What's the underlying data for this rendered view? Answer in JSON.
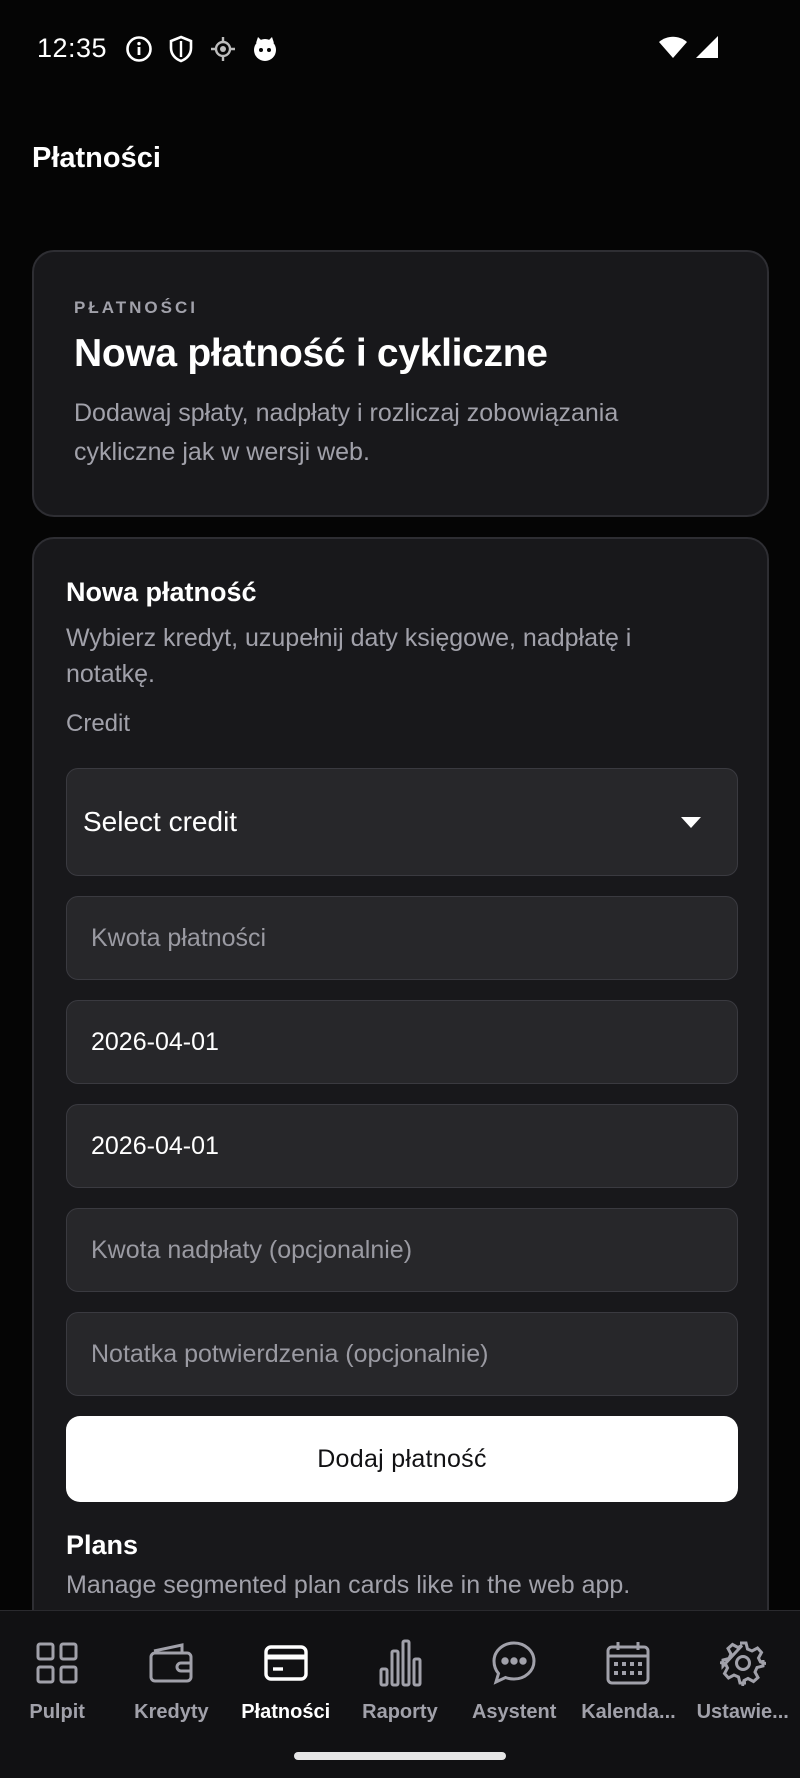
{
  "status_bar": {
    "time": "12:35",
    "icons": [
      "info-icon",
      "shield-icon",
      "location-icon",
      "cat-icon"
    ],
    "right_icons": [
      "wifi-icon",
      "signal-icon"
    ]
  },
  "header": {
    "title": "Płatności"
  },
  "hero": {
    "eyebrow": "PŁATNOŚCI",
    "title": "Nowa płatność i cykliczne",
    "description": "Dodawaj spłaty, nadpłaty i rozliczaj zobowiązania cykliczne jak w wersji web."
  },
  "form": {
    "title": "Nowa płatność",
    "description": "Wybierz kredyt, uzupełnij daty księgowe, nadpłatę i notatkę.",
    "credit_label": "Credit",
    "credit_select": {
      "value": "Select credit"
    },
    "amount": {
      "value": "",
      "placeholder": "Kwota płatności"
    },
    "date_1": {
      "value": "2026-04-01",
      "placeholder": ""
    },
    "date_2": {
      "value": "2026-04-01",
      "placeholder": ""
    },
    "overpayment": {
      "value": "",
      "placeholder": "Kwota nadpłaty (opcjonalnie)"
    },
    "note": {
      "value": "",
      "placeholder": "Notatka potwierdzenia (opcjonalnie)"
    },
    "submit_label": "Dodaj płatność"
  },
  "plans": {
    "title": "Plans",
    "description": "Manage segmented plan cards like in the web app."
  },
  "bottom_nav": {
    "items": [
      {
        "label": "Pulpit",
        "icon": "grid-icon",
        "active": false
      },
      {
        "label": "Kredyty",
        "icon": "wallet-icon",
        "active": false
      },
      {
        "label": "Płatności",
        "icon": "card-icon",
        "active": true
      },
      {
        "label": "Raporty",
        "icon": "bar-chart-icon",
        "active": false
      },
      {
        "label": "Asystent",
        "icon": "chat-icon",
        "active": false
      },
      {
        "label": "Kalenda...",
        "icon": "calendar-icon",
        "active": false
      },
      {
        "label": "Ustawie...",
        "icon": "gear-icon",
        "active": false
      }
    ]
  },
  "colors": {
    "background": "#050505",
    "card": "#18181b",
    "field": "#27272a",
    "muted_text": "#a1a1aa",
    "accent": "#ffffff"
  }
}
